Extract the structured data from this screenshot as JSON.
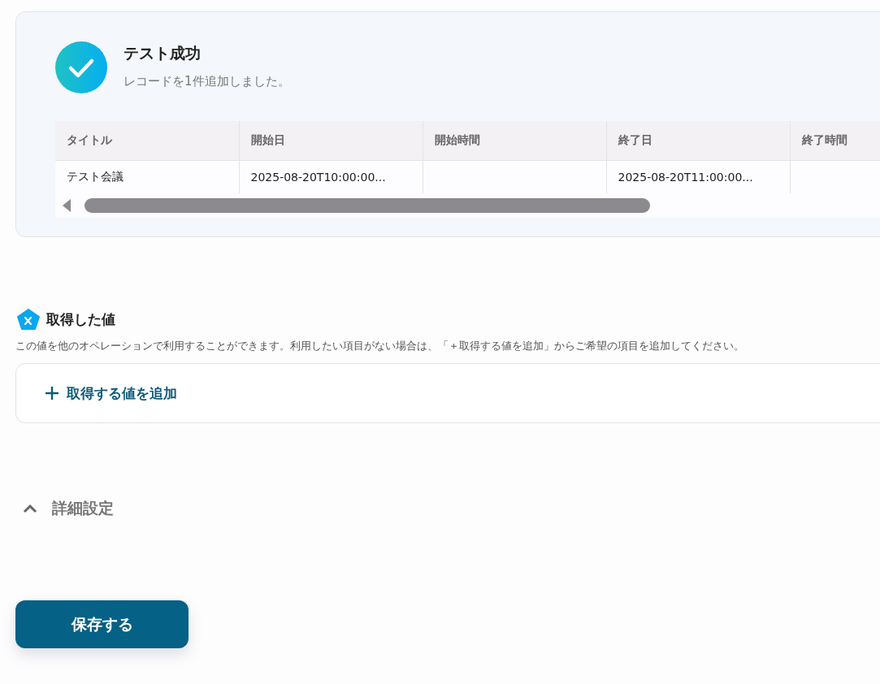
{
  "result": {
    "title": "テスト成功",
    "message": "レコードを1件追加しました。",
    "table": {
      "columns": [
        "タイトル",
        "開始日",
        "開始時間",
        "終了日",
        "終了時間"
      ],
      "rows": [
        [
          "テスト会議",
          "2025-08-20T10:00:00...",
          "",
          "2025-08-20T11:00:00...",
          ""
        ]
      ]
    }
  },
  "values": {
    "title": "取得した値",
    "description": "この値を他のオペレーションで利用することができます。利用したい項目がない場合は、「＋取得する値を追加」からご希望の項目を追加してください。",
    "add_button": "取得する値を追加"
  },
  "advanced": {
    "label": "詳細設定",
    "expanded": true
  },
  "save_button": "保存する"
}
